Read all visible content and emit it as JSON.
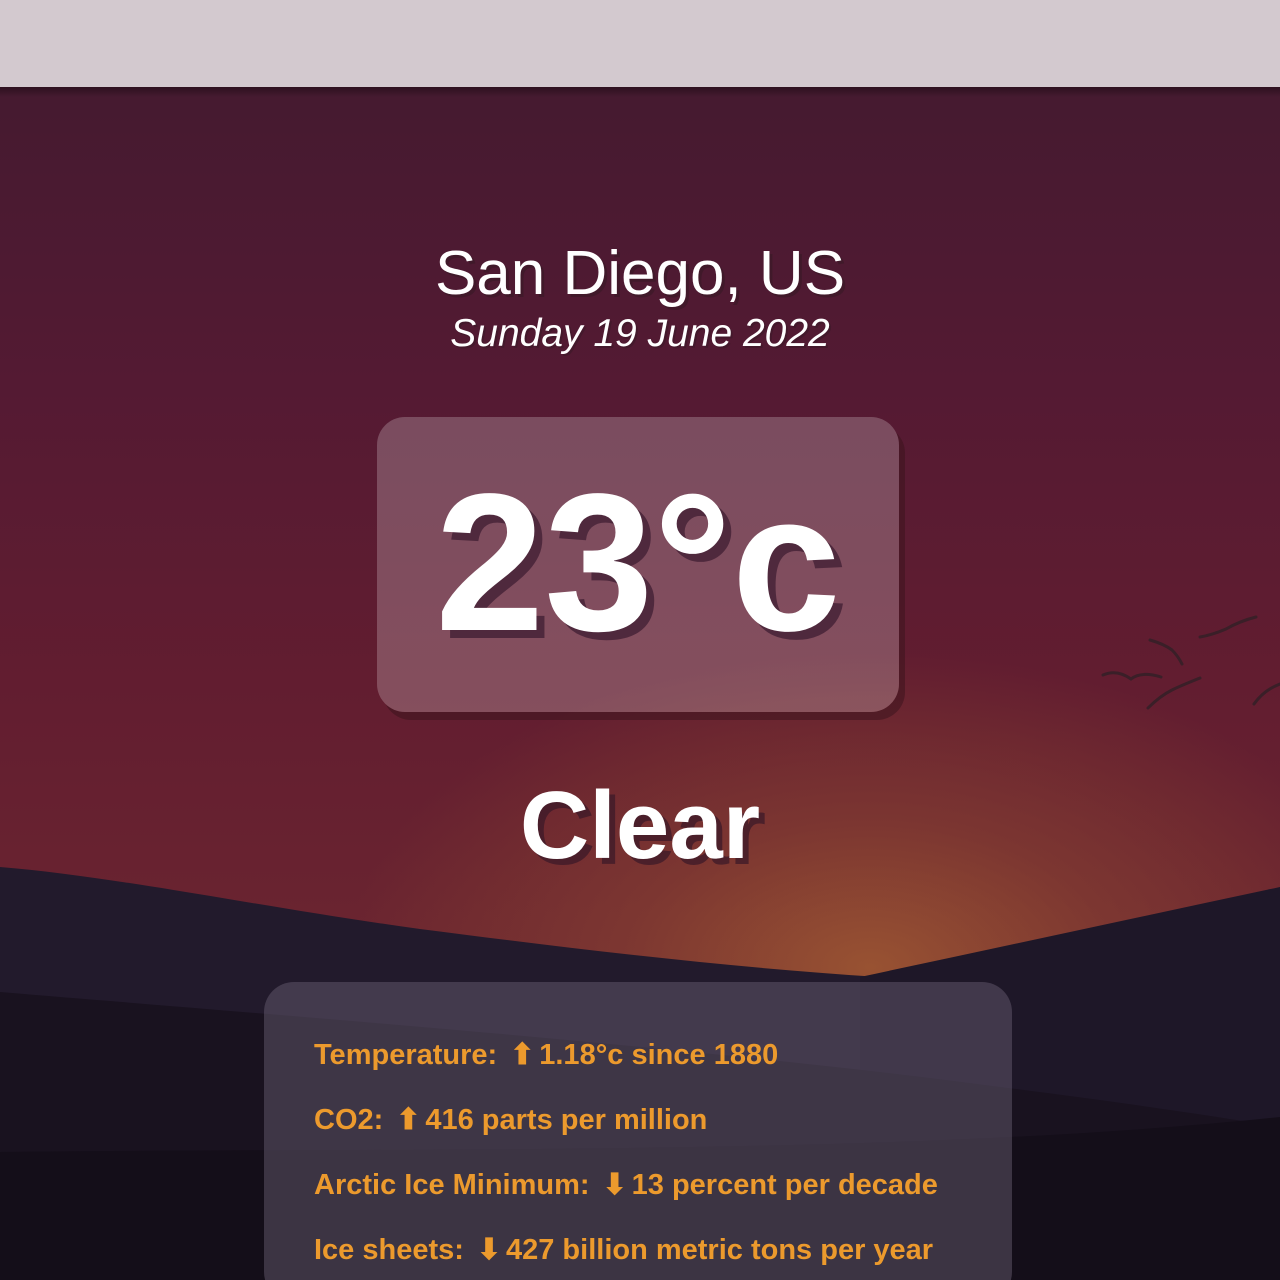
{
  "location": {
    "city": "San Diego, US",
    "date": "Sunday 19 June 2022"
  },
  "weather": {
    "temperature": "23°c",
    "condition": "Clear"
  },
  "climate_stats": [
    {
      "label": "Temperature:",
      "arrow": "⬆",
      "value": "1.18°c since 1880",
      "direction": "up"
    },
    {
      "label": "CO2:",
      "arrow": "⬆",
      "value": "416 parts per million",
      "direction": "up"
    },
    {
      "label": "Arctic Ice Minimum:",
      "arrow": "⬇",
      "value": "13 percent per decade",
      "direction": "down"
    },
    {
      "label": "Ice sheets:",
      "arrow": "⬇",
      "value": "427 billion metric tons per year",
      "direction": "down"
    }
  ],
  "colors": {
    "top_bar": "#d3c9cf",
    "stat_text": "#ec9a2d",
    "sky_top": "#451a30",
    "hills": "#1c1524"
  }
}
